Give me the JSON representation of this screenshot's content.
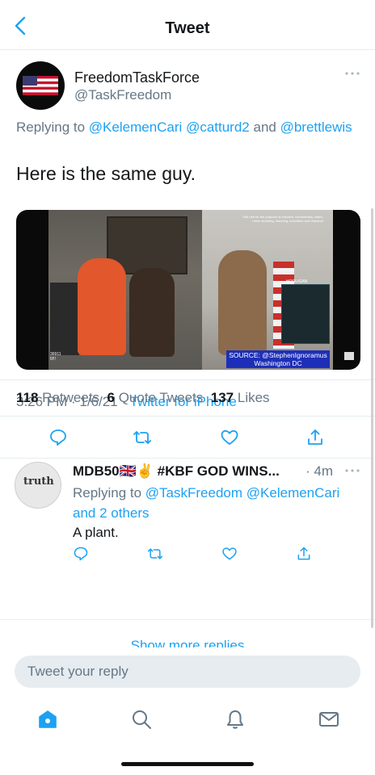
{
  "header": {
    "title": "Tweet"
  },
  "tweet": {
    "author_name": "FreedomTaskForce",
    "author_handle": "@TaskFreedom",
    "replying_prefix": "Replying to",
    "replying_mentions": [
      "@KelemenCari",
      "@catturd2"
    ],
    "replying_and": "and",
    "replying_last": "@brettlewis",
    "text": "Here is the same guy.",
    "media": {
      "caption": "Fair use for the purpose of criticism, commentary, satire, news reporting, teaching, education and research",
      "inset_tag": "HOOLIGAN",
      "views": "36911",
      "views_sub": "5!!!",
      "source_line1": "SOURCE: @StephenIgnoramus",
      "source_line2": "Washington DC"
    },
    "time": "3:26 PM · 1/6/21 ·",
    "client": "Twitter for iPhone",
    "stats": {
      "retweets_count": "118",
      "retweets_label": "Retweets",
      "quotes_count": "6",
      "quotes_label": "Quote Tweets",
      "likes_count": "137",
      "likes_label": "Likes"
    }
  },
  "reply": {
    "avatar_text": "truth",
    "name": "MDB50🇬🇧✌️ #KBF GOD WINS...",
    "time": "· 4m",
    "replying_prefix": "Replying to",
    "replying_mention1": "@TaskFreedom",
    "replying_mention2": "@KelemenCari",
    "replying_others": "and 2 others",
    "text": "A plant."
  },
  "show_more": "Show more replies",
  "composer": {
    "placeholder": "Tweet your reply"
  },
  "colors": {
    "accent": "#1da1f2",
    "secondary_text": "#657786",
    "divider": "#e6ecf0"
  },
  "icons": [
    "chevron-left-icon",
    "more-icon",
    "reply-icon",
    "retweet-icon",
    "like-icon",
    "share-icon",
    "home-icon",
    "search-icon",
    "notifications-icon",
    "messages-icon"
  ]
}
